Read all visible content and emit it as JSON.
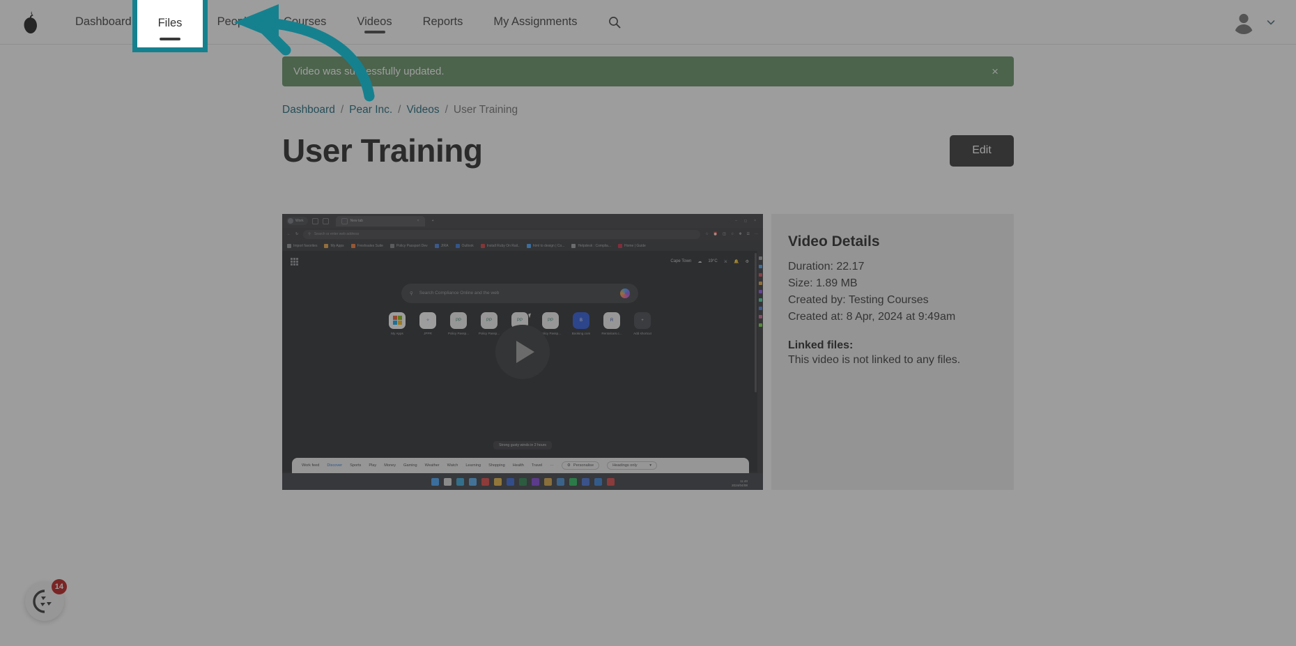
{
  "brand": {
    "logo_icon": "pear-logo"
  },
  "nav": {
    "items": [
      {
        "label": "Dashboard",
        "active": false
      },
      {
        "label": "Files",
        "active": false
      },
      {
        "label": "People",
        "active": false
      },
      {
        "label": "Courses",
        "active": false
      },
      {
        "label": "Videos",
        "active": true
      },
      {
        "label": "Reports",
        "active": false
      },
      {
        "label": "My Assignments",
        "active": false
      }
    ],
    "search_icon": "search-icon",
    "avatar_icon": "user-avatar-icon",
    "chevron_icon": "chevron-down-icon"
  },
  "highlight": {
    "target_label": "Files",
    "border_color": "#15818f",
    "arrow_color": "#15818f"
  },
  "alert": {
    "message": "Video was successfully updated.",
    "close_label": "×",
    "color": "#5c8a5c"
  },
  "breadcrumb": {
    "items": [
      "Dashboard",
      "Pear Inc.",
      "Videos",
      "User Training"
    ],
    "separator": "/",
    "link_color": "#0f5f72"
  },
  "header": {
    "title": "User Training",
    "edit_label": "Edit"
  },
  "video": {
    "play_icon": "play-button-icon",
    "thumbnail": {
      "browser_profile": "Work",
      "tab_title": "New tab",
      "tab_close": "×",
      "new_tab": "+",
      "url_placeholder": "Search or enter web address",
      "bookmarks": [
        "Import favorites",
        "My Apps",
        "Freshsales Suite",
        "Policy Passport Dev",
        "JIRA",
        "Outlook",
        "Install Ruby On Rail..",
        "html to design | Co...",
        "Helpdesk : Complia...",
        "Home | Guide"
      ],
      "location": "Cape Town",
      "temperature": "19°C",
      "notification_count": "1",
      "search_placeholder": "Search Compliance Online and the web",
      "shortcuts": [
        {
          "label": "My Apps",
          "glyph": ""
        },
        {
          "label": "JPPR",
          "glyph": ""
        },
        {
          "label": "Policy Passp...",
          "glyph": "PP"
        },
        {
          "label": "Policy Passp...",
          "glyph": "PP"
        },
        {
          "label": "Policy Passp...",
          "glyph": "PP"
        },
        {
          "label": "Policy Passp...",
          "glyph": "PP"
        },
        {
          "label": "Booking.com",
          "glyph": "B"
        },
        {
          "label": "Rentalcars.c...",
          "glyph": "R"
        },
        {
          "label": "Add shortcut",
          "glyph": "+"
        }
      ],
      "toast": "Strong gusty winds in 2 hours",
      "feed_tabs": [
        "Work feed",
        "Discover",
        "Sports",
        "Play",
        "Money",
        "Gaming",
        "Weather",
        "Watch",
        "Learning",
        "Shopping",
        "Health",
        "Travel",
        "···"
      ],
      "feed_active": "Discover",
      "personalise_label": "Personalise",
      "headings_label": "Headings only",
      "clock_time": "11:40",
      "clock_date": "2024/04/08"
    }
  },
  "details": {
    "title": "Video Details",
    "lines": [
      "Duration: 22.17",
      "Size: 1.89 MB",
      "Created by: Testing Courses",
      "Created at: 8 Apr, 2024 at 9:49am"
    ],
    "linked_label": "Linked files:",
    "linked_value": "This video is not linked to any files."
  },
  "chat": {
    "icon": "chat-widget-icon",
    "badge": "14",
    "badge_color": "#b80f0f"
  }
}
